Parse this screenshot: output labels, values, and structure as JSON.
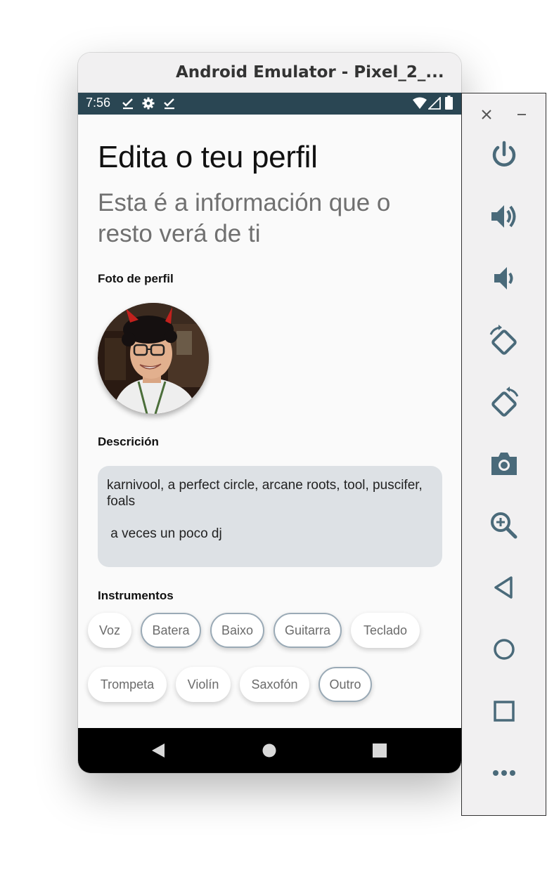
{
  "window": {
    "title": "Android Emulator - Pixel_2_..."
  },
  "status_bar": {
    "time": "7:56",
    "icons": [
      "check-icon",
      "settings-gear-icon",
      "check-icon",
      "wifi-icon",
      "signal-icon",
      "battery-icon"
    ]
  },
  "page": {
    "title": "Edita o teu perfil",
    "subtitle": "Esta é a información que o resto verá de ti",
    "photo_label": "Foto de perfil",
    "description_label": "Descrición",
    "description_text": "karnivool, a perfect circle, arcane roots, tool, puscifer, foals\n\n a veces un poco dj",
    "instruments_label": "Instrumentos",
    "instruments": [
      {
        "label": "Voz",
        "selected": false
      },
      {
        "label": "Batera",
        "selected": true
      },
      {
        "label": "Baixo",
        "selected": true
      },
      {
        "label": "Guitarra",
        "selected": true
      },
      {
        "label": "Teclado",
        "selected": false
      },
      {
        "label": "Trompeta",
        "selected": false
      },
      {
        "label": "Violín",
        "selected": false
      },
      {
        "label": "Saxofón",
        "selected": false
      },
      {
        "label": "Outro",
        "selected": true
      }
    ]
  },
  "nav_bar": [
    "back-triangle-icon",
    "home-circle-icon",
    "recents-square-icon"
  ],
  "toolbar": [
    "close-icon",
    "minimize-icon",
    "power-icon",
    "volume-up-icon",
    "volume-down-icon",
    "rotate-left-icon",
    "rotate-right-icon",
    "camera-icon",
    "zoom-icon",
    "back-icon",
    "home-icon",
    "overview-icon",
    "more-icon"
  ],
  "colors": {
    "status_bar": "#2a4653",
    "accent_border": "#9aaab6",
    "description_bg": "#dde1e5",
    "toolbar_icon": "#4a6a7a"
  }
}
